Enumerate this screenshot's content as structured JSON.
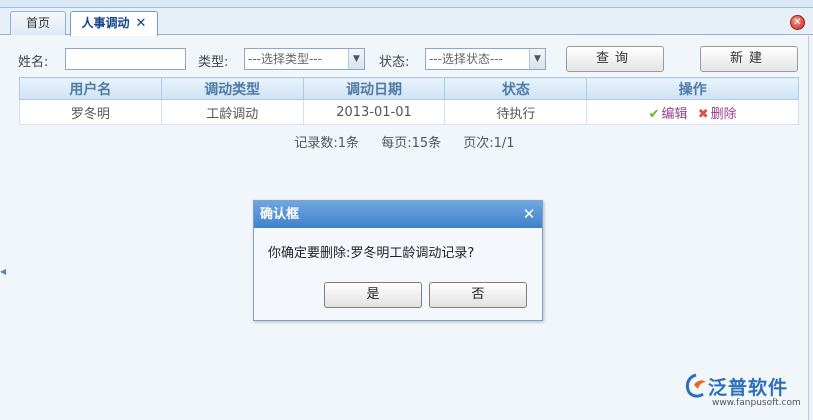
{
  "tabs": [
    {
      "label": "首页"
    },
    {
      "label": "人事调动",
      "close_symbol": "✕"
    }
  ],
  "search": {
    "name_label": "姓名:",
    "name_value": "",
    "type_label": "类型:",
    "type_selected": "---选择类型---",
    "status_label": "状态:",
    "status_selected": "---选择状态---",
    "query_button": "查询",
    "new_button": "新建"
  },
  "table": {
    "headers": [
      "用户名",
      "调动类型",
      "调动日期",
      "状态",
      "操作"
    ],
    "rows": [
      {
        "user": "罗冬明",
        "type": "工龄调动",
        "date": "2013-01-01",
        "status": "待执行",
        "edit": "编辑",
        "delete": "删除"
      }
    ]
  },
  "pager": {
    "records": "记录数:1条",
    "per_page": "每页:15条",
    "page": "页次:1/1"
  },
  "dialog": {
    "title": "确认框",
    "message": "你确定要删除:罗冬明工龄调动记录?",
    "yes": "是",
    "no": "否"
  },
  "logo": {
    "name": "泛普软件",
    "url": "www.fanpusoft.com"
  },
  "colors": {
    "header_text": "#4f7ca6",
    "dialog_header": "#3f82c9",
    "action_link": "#9a3f8f",
    "edit_icon": "#5fb72a",
    "delete_icon": "#e0503c",
    "close_button": "#c9231a"
  },
  "icons": {
    "edit": "check-icon",
    "delete": "x-icon",
    "panel_close": "close-circle-icon",
    "dialog_close": "close-icon",
    "select_arrow": "chevron-down-icon"
  }
}
